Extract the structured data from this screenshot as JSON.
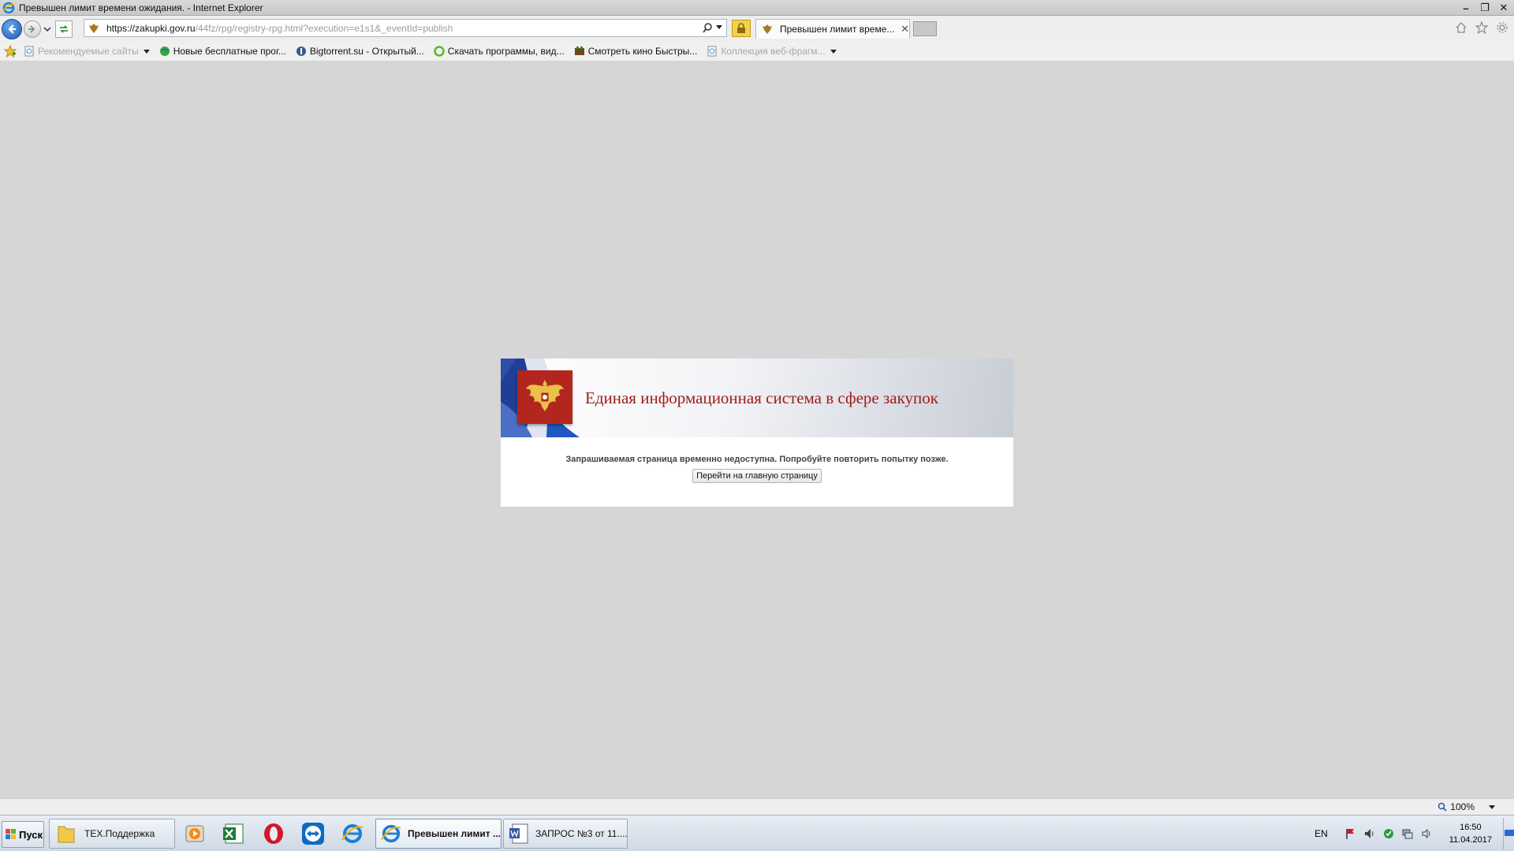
{
  "window": {
    "title": "Превышен лимит времени ожидания. - Internet Explorer",
    "minimize_label": "–",
    "maximize_label": "❐",
    "close_label": "✕"
  },
  "address": {
    "url_host": "https://zakupki.gov.ru",
    "url_path": "/44fz/rpg/registry-rpg.html?execution=e1s1&_eventId=publish"
  },
  "tab": {
    "label": "Превышен лимит време...",
    "close_label": "✕"
  },
  "favorites": [
    {
      "label": "Рекомендуемые сайты",
      "dim": true,
      "dropdown": true
    },
    {
      "label": "Новые бесплатные прог...",
      "dim": false
    },
    {
      "label": "Bigtorrent.su - Открытый...",
      "dim": false
    },
    {
      "label": "Скачать программы, вид...",
      "dim": false
    },
    {
      "label": "Смотреть кино  Быстры...",
      "dim": false
    },
    {
      "label": "Коллекция веб-фрагм...",
      "dim": true,
      "dropdown": true
    }
  ],
  "page": {
    "title": "Единая информационная система в сфере закупок",
    "message": "Запрашиваемая страница временно недоступна. Попробуйте повторить попытку позже.",
    "button_label": "Перейти на главную страницу"
  },
  "status": {
    "zoom": "100%"
  },
  "taskbar": {
    "start_label": "Пуск",
    "tasks": [
      {
        "label": "ТЕХ.Поддержка"
      },
      {
        "label": "Превышен лимит ..."
      },
      {
        "label": "ЗАПРОС №3 от 11...."
      }
    ],
    "language": "EN",
    "time": "16:50",
    "date": "11.04.2017"
  },
  "colors": {
    "page_background": "#d6d6d6",
    "title_red": "#9f1b1b",
    "emblem_red": "#b3261e",
    "lock_yellow": "#f4d04e"
  }
}
